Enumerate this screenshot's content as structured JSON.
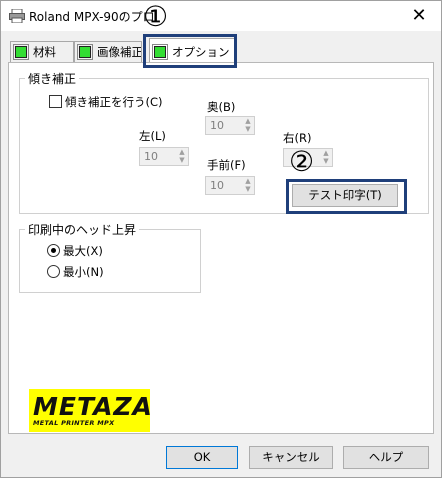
{
  "window": {
    "title": "Roland MPX-90のプロ"
  },
  "callouts": {
    "one": "①",
    "two": "②"
  },
  "tabs": [
    {
      "label": "材料",
      "led_color": "#33dd33"
    },
    {
      "label": "画像補正",
      "led_color": "#33dd33"
    },
    {
      "label": "オプション",
      "led_color": "#33dd33"
    }
  ],
  "tilt": {
    "group_label": "傾き補正",
    "checkbox_label": "傾き補正を行う(C)",
    "checked": false,
    "left_label": "左(L)",
    "left_value": "10",
    "back_label": "奥(B)",
    "back_value": "10",
    "right_label": "右(R)",
    "front_label": "手前(F)",
    "front_value": "10",
    "test_button": "テスト印字(T)"
  },
  "head": {
    "group_label": "印刷中のヘッド上昇",
    "max_label": "最大(X)",
    "min_label": "最小(N)",
    "selected": "max"
  },
  "logo": {
    "main": "METAZA",
    "sub": "METAL PRINTER  MPX"
  },
  "buttons": {
    "ok": "OK",
    "cancel": "キャンセル",
    "help": "ヘルプ"
  }
}
